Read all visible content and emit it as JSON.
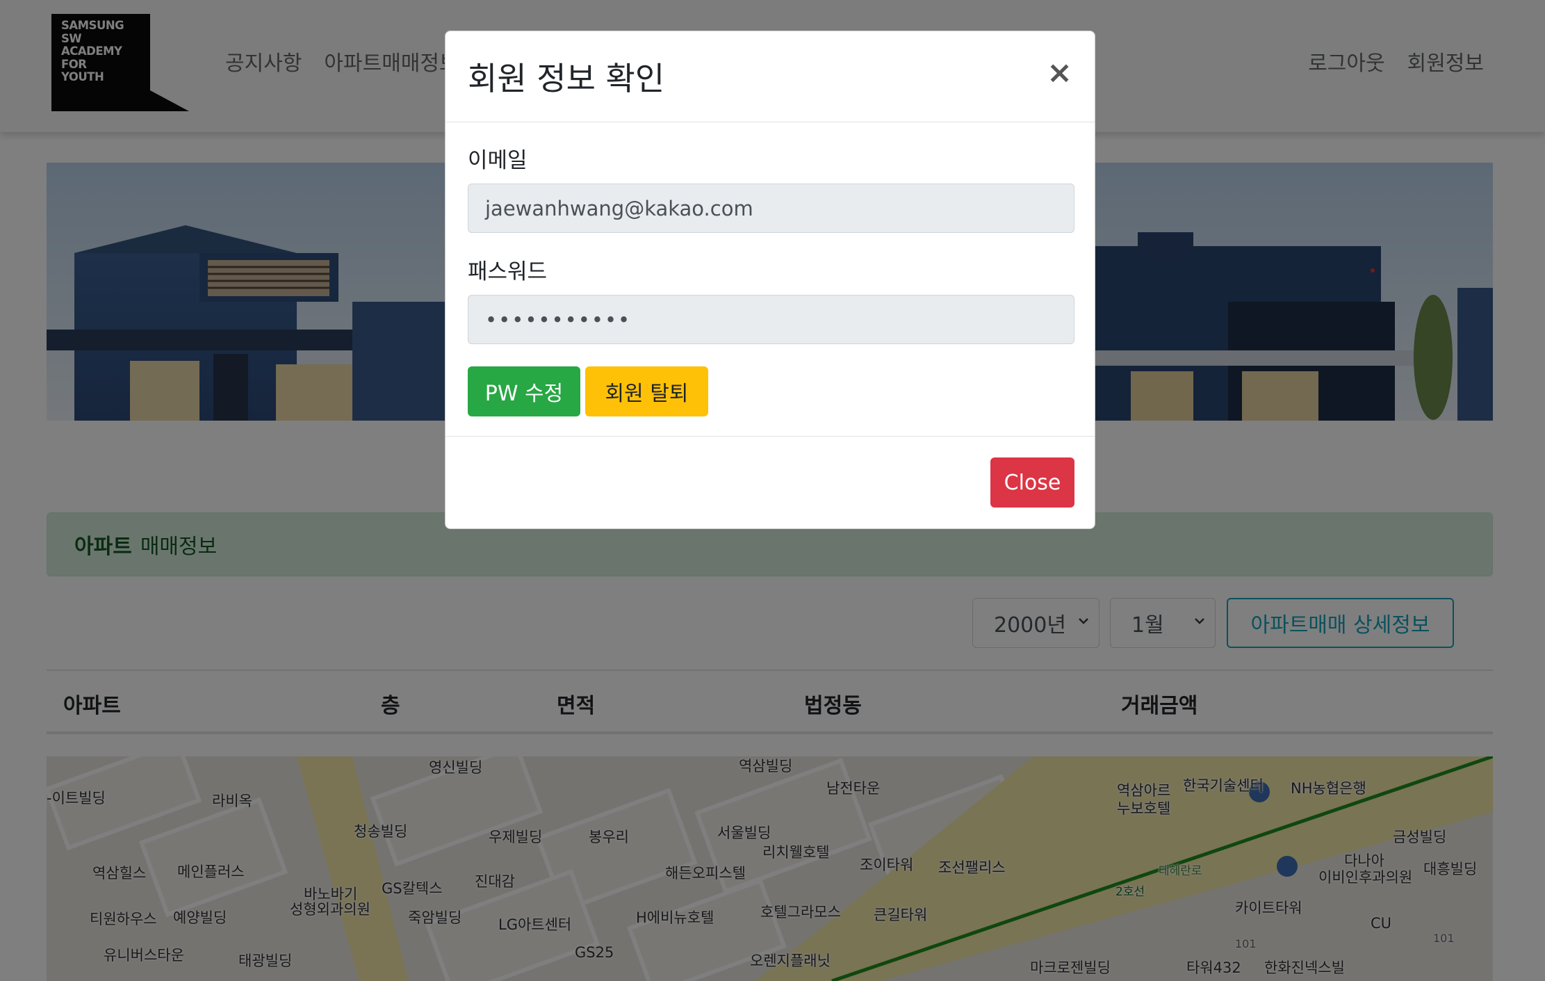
{
  "navbar": {
    "logo_text": "SAMSUNG\nSW\nACADEMY\nFOR\nYOUTH",
    "left_links": [
      "공지사항",
      "아파트매매정보"
    ],
    "right_links": [
      "로그아웃",
      "회원정보"
    ]
  },
  "alert": {
    "bold": "아파트",
    "text": "매매정보"
  },
  "filters": {
    "year": "2000년",
    "month": "1월",
    "detail_button": "아파트매매 상세정보"
  },
  "table": {
    "headers": [
      "아파트",
      "층",
      "면적",
      "법정동",
      "거래금액"
    ]
  },
  "map": {
    "labels": [
      "영신빌딩",
      "역삼빌딩",
      "남전타운",
      "역삼아르누보호텔",
      "한국기술센터",
      "NH농협은행",
      "-이트빌딩",
      "라비옥",
      "청송빌딩",
      "우제빌딩",
      "봉우리",
      "서울빌딩",
      "리치웰호텔",
      "조이타워",
      "조선팰리스",
      "금성빌딩",
      "다나아",
      "이비인후과의원",
      "대흥빌딩",
      "역삼힐스",
      "메인플러스",
      "바노바기",
      "성형외과의원",
      "GS칼텍스",
      "진대감",
      "해든오피스텔",
      "티원하우스",
      "예양빌딩",
      "죽암빌딩",
      "LG아트센터",
      "H에비뉴호텔",
      "호텔그라모스",
      "큰길타워",
      "카이트타워",
      "CU",
      "유니버스타운",
      "태광빌딩",
      "GS25",
      "오렌지플래닛",
      "마크로젠빌딩",
      "타워432",
      "한화진넥스빌",
      "2호선",
      "테헤란로",
      "101",
      "101"
    ]
  },
  "modal": {
    "title": "회원 정보 확인",
    "close_icon": "×",
    "email_label": "이메일",
    "email_value": "jaewanhwang@kakao.com",
    "password_label": "패스워드",
    "password_value": "•••••••••••",
    "pw_button": "PW 수정",
    "withdraw_button": "회원 탈퇴",
    "close_button": "Close"
  },
  "colors": {
    "success": "#28a745",
    "warning": "#ffc107",
    "danger": "#dc3545",
    "info": "#17a2b8",
    "alert_bg": "#d4edda",
    "alert_text": "#155724"
  }
}
